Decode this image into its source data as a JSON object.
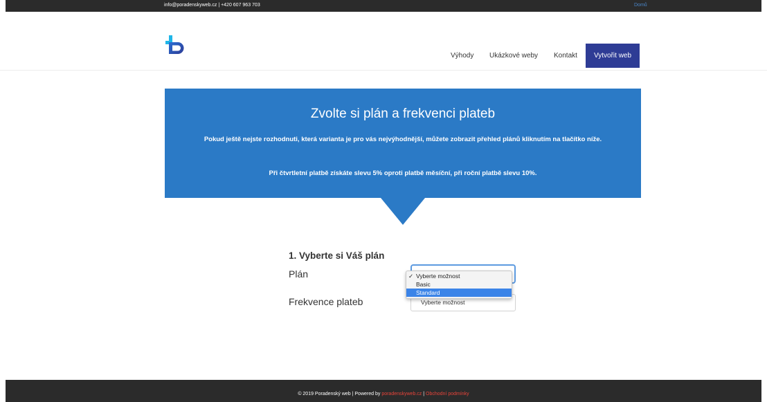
{
  "topbar": {
    "contact": "info@poradenskyweb.cz | +420 607 963 703",
    "home_link": "Domů"
  },
  "header": {
    "logo_icon": "b-logo-icon",
    "nav": [
      "Výhody",
      "Ukázkové weby",
      "Kontakt"
    ],
    "cta_label": "Vytvořit web"
  },
  "hero": {
    "title": "Zvolte si plán a frekvenci plateb",
    "text1": "Pokud ještě nejste rozhodnuti, která varianta je pro vás nejvýhodnější, můžete zobrazit přehled plánů kliknutím na tlačítko níže.",
    "text2": "Při čtvrtletní platbě získáte slevu 5% oproti platbě měsíční, při roční platbě slevu 10%."
  },
  "form": {
    "section_title": "1. Vyberte si Váš plán",
    "plan_label": "Plán",
    "plan_options": [
      "Vyberte možnost",
      "Basic",
      "Standard"
    ],
    "plan_checked_index": 0,
    "plan_highlighted_index": 2,
    "frequency_label": "Frekvence plateb",
    "frequency_value": "Vyberte možnost"
  },
  "footer": {
    "text": "© 2019 Poradenský web | Powered by ",
    "powered_link": "poradenskyweb.cz",
    "separator": " | ",
    "terms_link": "Obchodní podmínky"
  },
  "colors": {
    "accent_blue": "#2b7ac6",
    "cta_navy": "#2e3c95",
    "topbar_dark": "#2b2b2b",
    "footer_link_red": "#e8443a",
    "dropdown_highlight": "#3b84e8"
  }
}
